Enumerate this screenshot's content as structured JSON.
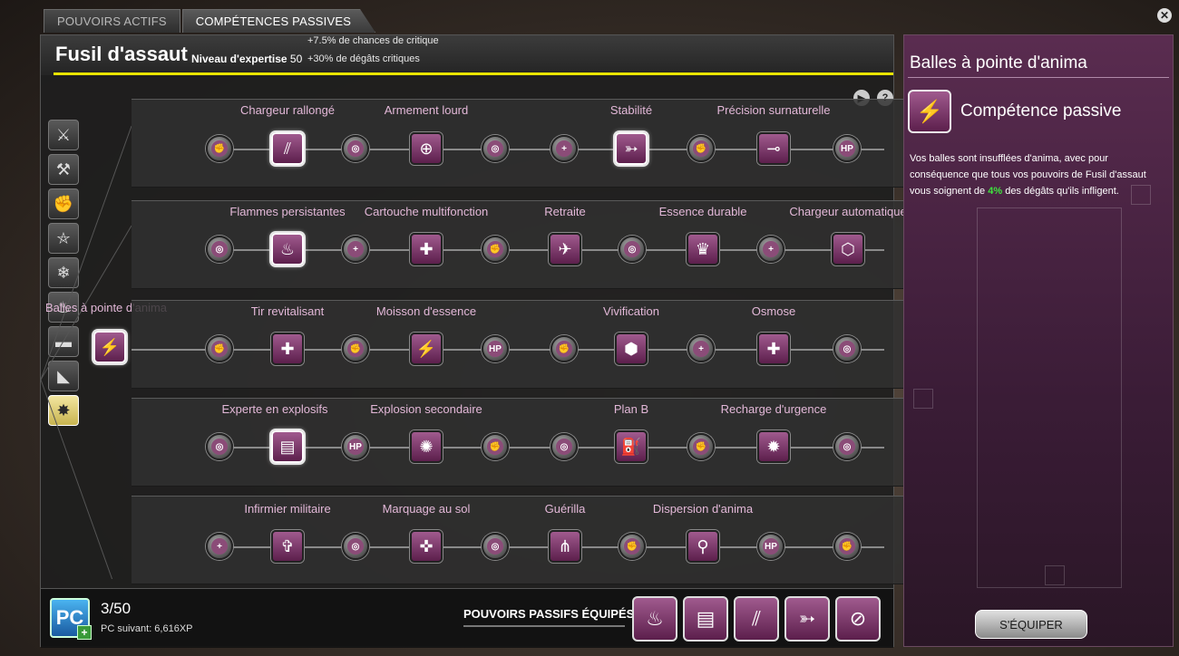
{
  "tabs": [
    {
      "label": "POUVOIRS ACTIFS",
      "active": false
    },
    {
      "label": "COMPÉTENCES PASSIVES",
      "active": true
    }
  ],
  "header": {
    "title": "Fusil d'assaut",
    "level_label": "Niveau d'expertise",
    "level_value": "50",
    "bonus_1": "+7.5% de chances de critique",
    "bonus_2": "+30% de dégâts critiques"
  },
  "weapon_icons": [
    "blade-icon",
    "hammer-icon",
    "fist-icon",
    "pentagram-icon",
    "snowflake-icon",
    "flame-icon",
    "shotgun-icon",
    "pistol-icon",
    "assault-rifle-icon"
  ],
  "root_skill": "Balles à pointe d'anima",
  "rows": [
    {
      "labels": [
        "Chargeur rallongé",
        "Armement lourd",
        "Stabilité",
        "Précision surnaturelle"
      ]
    },
    {
      "labels": [
        "Flammes persistantes",
        "Cartouche multifonction",
        "Retraite",
        "Essence durable",
        "Chargeur automatique"
      ]
    },
    {
      "labels": [
        "Tir revitalisant",
        "Moisson d'essence",
        "Vivification",
        "Osmose"
      ]
    },
    {
      "labels": [
        "Experte en explosifs",
        "Explosion secondaire",
        "Plan B",
        "Recharge d'urgence"
      ]
    },
    {
      "labels": [
        "Infirmier militaire",
        "Marquage au sol",
        "Guérilla",
        "Dispersion d'anima"
      ]
    }
  ],
  "footer": {
    "pc_logo": "PC",
    "pc_count": "3/50",
    "pc_next": "PC suivant: 6,616XP",
    "equipped_label": "POUVOIRS PASSIFS ÉQUIPÉS"
  },
  "detail": {
    "title": "Balles à pointe d'anima",
    "type": "Compétence passive",
    "desc_before": "Vos balles sont insufflées d'anima, avec pour conséquence que tous vos pouvoirs de Fusil d'assaut vous soignent de ",
    "desc_pct": "4%",
    "desc_after": " des dégâts qu'ils infligent.",
    "equip_button": "S'ÉQUIPER"
  },
  "colors": {
    "accent": "#e9e400",
    "skill": "#8b4c78",
    "label": "#e3b8d8"
  }
}
